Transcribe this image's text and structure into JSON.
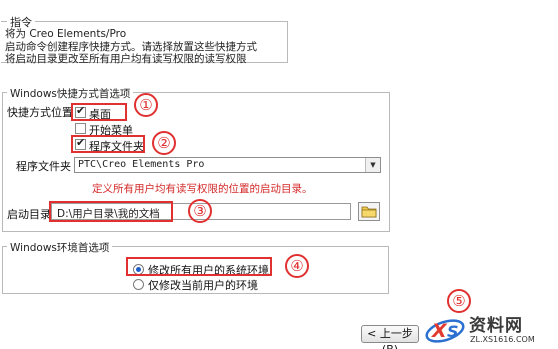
{
  "instructions": {
    "legend": "指令",
    "line1": "将为 Creo Elements/Pro",
    "line2": "启动命令创建程序快捷方式。请选择放置这些快捷方式",
    "line3": "将启动目录更改至所有用户均有读写权限的读写权限"
  },
  "shortcut_prefs": {
    "legend": "Windows快捷方式首选项",
    "location_label": "快捷方式位置",
    "options": [
      {
        "label": "桌面",
        "checked": true
      },
      {
        "label": "开始菜单",
        "checked": false
      },
      {
        "label": "程序文件夹",
        "checked": true
      }
    ],
    "program_folder_label": "程序文件夹",
    "program_folder_value": "PTC\\Creo Elements Pro",
    "warning": "定义所有用户均有读写权限的位置的启动目录。",
    "startup_dir_label": "启动目录",
    "startup_dir_value": "D:\\用户目录\\我的文档"
  },
  "env_prefs": {
    "legend": "Windows环境首选项",
    "options": [
      {
        "label": "修改所有用户的系统环境",
        "selected": true
      },
      {
        "label": "仅修改当前用户的环境",
        "selected": false
      }
    ]
  },
  "annotations": [
    "①",
    "②",
    "③",
    "④",
    "⑤"
  ],
  "navigation": {
    "back_label": "< 上一步 (B)"
  },
  "watermark": {
    "name": "资料网",
    "url": "ZL.XS1616.COM"
  },
  "colors": {
    "annotation_red": "#e03030",
    "warning_red": "#d42a2a",
    "radio_blue": "#1e5ec8"
  },
  "icons": {
    "folder": "folder-icon",
    "dropdown": "chevron-down-icon"
  }
}
